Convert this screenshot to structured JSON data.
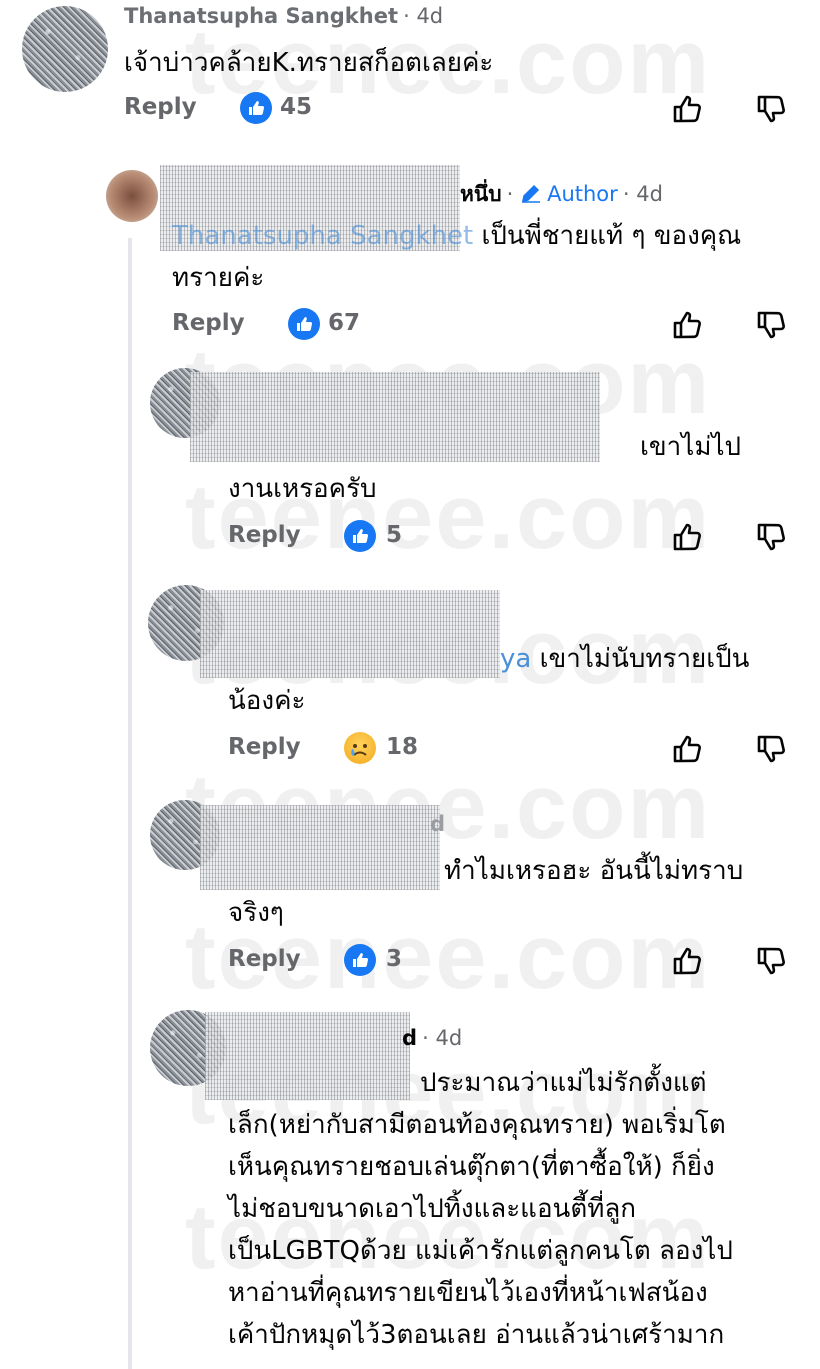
{
  "watermark": "teenee.com",
  "comments": [
    {
      "author": "Thanatsupha Sangkhet",
      "time": "· 4d",
      "text": "เจ้าบ่าวคล้ายK.ทรายสก็อตเลยค่ะ",
      "reply": "Reply",
      "reaction": "like",
      "count": "45"
    },
    {
      "author_visible": "หนึ่บ",
      "author_badge": "Author",
      "time": "· 4d",
      "mention": "Thanatsupha Sangkhet",
      "text_line1": "เป็นพี่ชายแท้ ๆ ของคุณ",
      "text_line2": "ทรายค่ะ",
      "reply": "Reply",
      "reaction": "like",
      "count": "67"
    },
    {
      "text_line1": "เขาไม่ไป",
      "text_line2": "งานเหรอครับ",
      "reply": "Reply",
      "reaction": "like",
      "count": "5"
    },
    {
      "mention_tail": "ya",
      "text_line1": "เขาไม่นับทรายเป็น",
      "text_line2": "น้องค่ะ",
      "reply": "Reply",
      "reaction": "sad",
      "count": "18"
    },
    {
      "author_tail": "d",
      "text_line1": "ทำไมเหรอฮะ อันนี้ไม่ทราบ",
      "text_line2": "จริงๆ",
      "reply": "Reply",
      "reaction": "like",
      "count": "3"
    },
    {
      "author_tail": "d",
      "time": "4d",
      "lines": [
        "ประมาณว่าแม่ไม่รักตั้งแต่",
        "เล็ก(หย่ากับสามีตอนท้องคุณทราย) พอเริ่มโต",
        "เห็นคุณทรายชอบเล่นตุ๊กตา(ที่ตาซื้อให้) ก็ยิ่ง",
        "ไม่ชอบขนาดเอาไปทิ้งและแอนตี้ที่ลูก",
        "เป็นLGBTQด้วย แม่เค้ารักแต่ลูกคนโต ลองไป",
        "หาอ่านที่คุณทรายเขียนไว้เองที่หน้าเฟสน้อง",
        "เค้าปักหมุดไว้3ตอนเลย อ่านแล้วน่าเศร้ามาก"
      ]
    }
  ],
  "colors": {
    "link": "#1877f2",
    "meta": "#65676b",
    "text": "#050505"
  },
  "icons": {
    "like_badge": "thumbs-up-icon",
    "sad_badge": "crying-face-icon",
    "upvote": "thumbs-up-outline-icon",
    "downvote": "thumbs-down-outline-icon",
    "author_badge": "pencil-icon"
  }
}
